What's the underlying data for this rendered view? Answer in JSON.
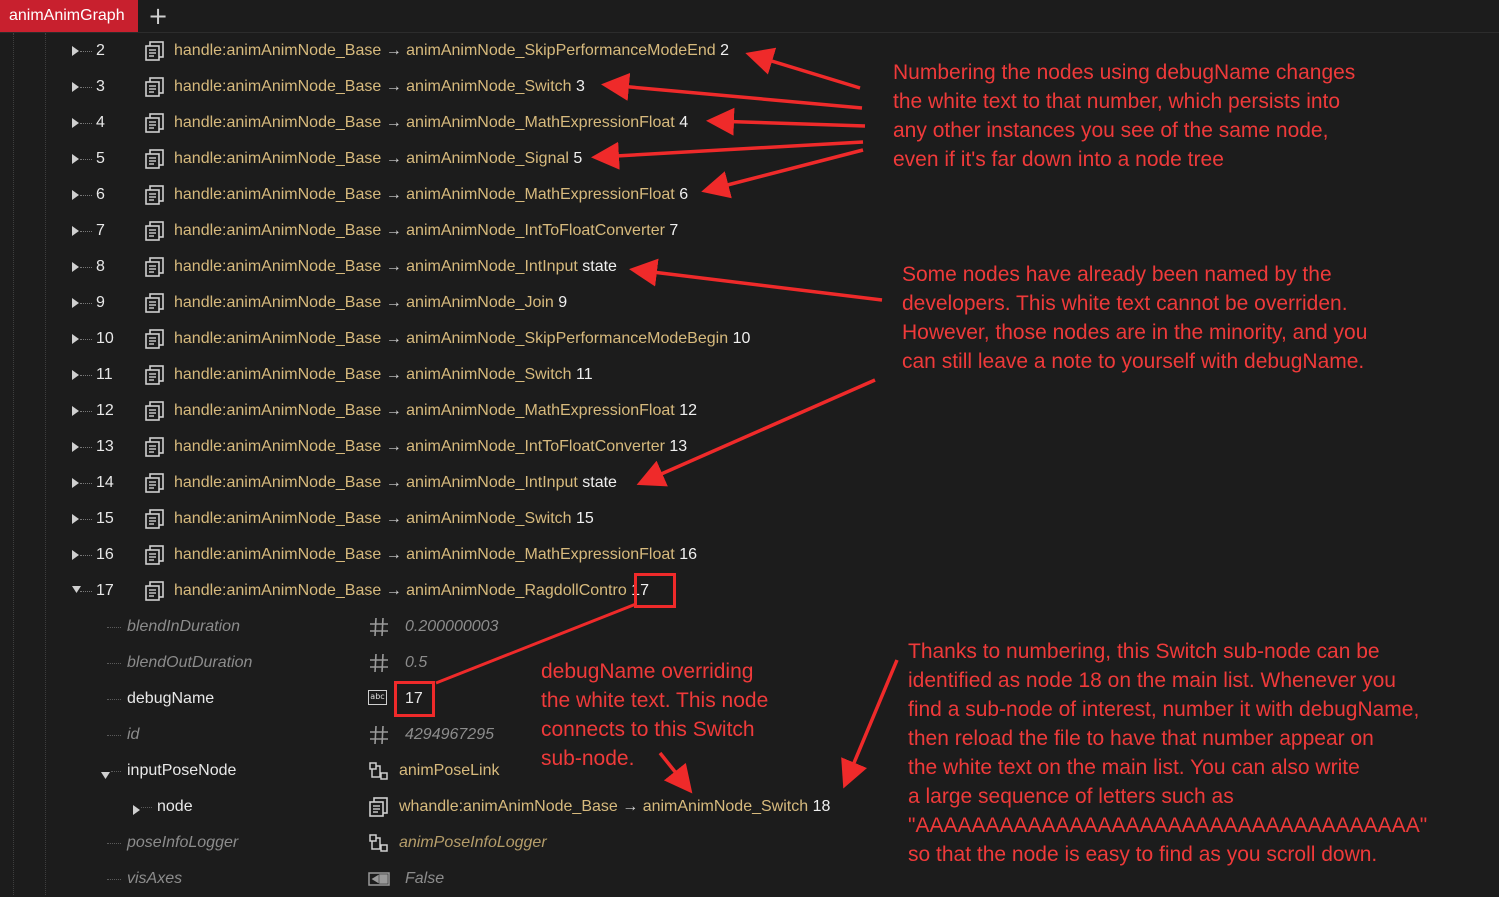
{
  "tab": {
    "label": "animAnimGraph",
    "add_symbol": "+"
  },
  "rows": [
    {
      "index": "2",
      "handle": "handle:animAnimNode_Base",
      "arrow": "→",
      "type": "animAnimNode_SkipPerformanceModeEnd",
      "name": "2"
    },
    {
      "index": "3",
      "handle": "handle:animAnimNode_Base",
      "arrow": "→",
      "type": "animAnimNode_Switch",
      "name": "3"
    },
    {
      "index": "4",
      "handle": "handle:animAnimNode_Base",
      "arrow": "→",
      "type": "animAnimNode_MathExpressionFloat",
      "name": "4"
    },
    {
      "index": "5",
      "handle": "handle:animAnimNode_Base",
      "arrow": "→",
      "type": "animAnimNode_Signal",
      "name": "5"
    },
    {
      "index": "6",
      "handle": "handle:animAnimNode_Base",
      "arrow": "→",
      "type": "animAnimNode_MathExpressionFloat",
      "name": "6"
    },
    {
      "index": "7",
      "handle": "handle:animAnimNode_Base",
      "arrow": "→",
      "type": "animAnimNode_IntToFloatConverter",
      "name": "7"
    },
    {
      "index": "8",
      "handle": "handle:animAnimNode_Base",
      "arrow": "→",
      "type": "animAnimNode_IntInput",
      "name": "state"
    },
    {
      "index": "9",
      "handle": "handle:animAnimNode_Base",
      "arrow": "→",
      "type": "animAnimNode_Join",
      "name": "9"
    },
    {
      "index": "10",
      "handle": "handle:animAnimNode_Base",
      "arrow": "→",
      "type": "animAnimNode_SkipPerformanceModeBegin",
      "name": "10"
    },
    {
      "index": "11",
      "handle": "handle:animAnimNode_Base",
      "arrow": "→",
      "type": "animAnimNode_Switch",
      "name": "11"
    },
    {
      "index": "12",
      "handle": "handle:animAnimNode_Base",
      "arrow": "→",
      "type": "animAnimNode_MathExpressionFloat",
      "name": "12"
    },
    {
      "index": "13",
      "handle": "handle:animAnimNode_Base",
      "arrow": "→",
      "type": "animAnimNode_IntToFloatConverter",
      "name": "13"
    },
    {
      "index": "14",
      "handle": "handle:animAnimNode_Base",
      "arrow": "→",
      "type": "animAnimNode_IntInput",
      "name": "state"
    },
    {
      "index": "15",
      "handle": "handle:animAnimNode_Base",
      "arrow": "→",
      "type": "animAnimNode_Switch",
      "name": "15"
    },
    {
      "index": "16",
      "handle": "handle:animAnimNode_Base",
      "arrow": "→",
      "type": "animAnimNode_MathExpressionFloat",
      "name": "16"
    },
    {
      "index": "17",
      "handle": "handle:animAnimNode_Base",
      "arrow": "→",
      "type": "animAnimNode_RagdollContro",
      "name": "17",
      "expanded": true
    }
  ],
  "properties": {
    "blendInDuration": {
      "label": "blendInDuration",
      "value": "0.200000003",
      "icon": "hash-icon"
    },
    "blendOutDuration": {
      "label": "blendOutDuration",
      "value": "0.5",
      "icon": "hash-icon"
    },
    "debugName": {
      "label": "debugName",
      "value": "17",
      "icon": "abc-text-icon",
      "icon_text": "abc"
    },
    "id": {
      "label": "id",
      "value": "4294967295",
      "icon": "hash-icon"
    },
    "inputPoseNode": {
      "label": "inputPoseNode",
      "value": "animPoseLink",
      "icon": "link-icon"
    },
    "node": {
      "label": "node",
      "handle": "whandle:animAnimNode_Base",
      "arrow": "→",
      "type": "animAnimNode_Switch",
      "name": "18",
      "icon": "node-handle-icon"
    },
    "poseInfoLogger": {
      "label": "poseInfoLogger",
      "value": "animPoseInfoLogger",
      "icon": "link-icon"
    },
    "visAxes": {
      "label": "visAxes",
      "value": "False",
      "icon": "bool-icon"
    }
  },
  "annotations": {
    "note1": [
      "Numbering the nodes using debugName changes",
      "the white text to that number, which persists into",
      "any other instances you see of the same node,",
      "even if it's far down into a node tree"
    ],
    "note2": [
      "Some nodes have already been named by the",
      "developers. This white text cannot be overriden.",
      "However, those nodes are in the minority, and you",
      "can still leave a note to yourself with debugName."
    ],
    "note3": [
      "debugName overriding",
      "the white text. This node",
      "connects to this Switch",
      "sub-node."
    ],
    "note4": [
      "Thanks to numbering, this Switch sub-node can be",
      "identified as node 18 on the main list. Whenever you",
      "find a sub-node of interest, number it with debugName,",
      "then reload the file to have that number appear on",
      "the white text on the main list. You can also write",
      "a large sequence of letters such as",
      "\"AAAAAAAAAAAAAAAAAAAAAAAAAAAAAAAAAAAA\"",
      "so that the node is easy to find as you scroll down."
    ]
  },
  "colors": {
    "background": "#1c1c1c",
    "tab_active": "#c8202e",
    "handle_text": "#d7ba7d",
    "annotation": "#ef3a3a"
  }
}
